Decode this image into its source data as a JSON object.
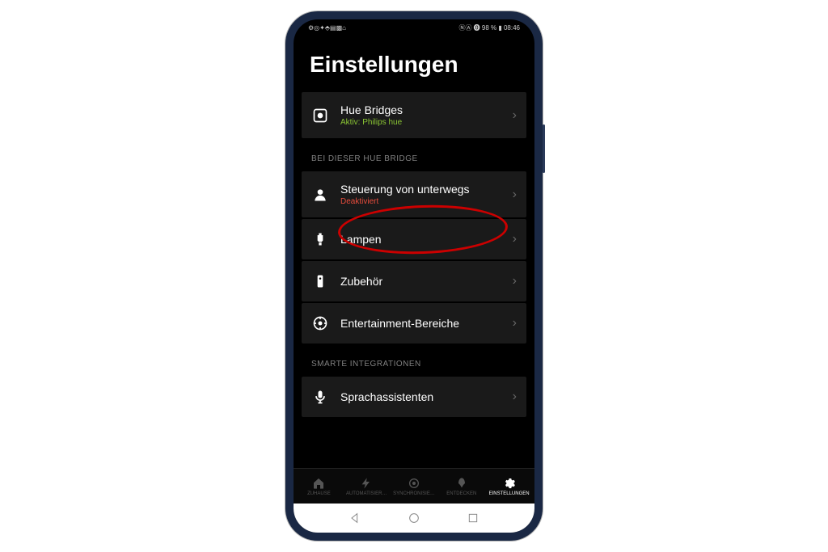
{
  "statusBar": {
    "leftIcons": "⚙◎✦⬘▤▩⌂",
    "rightText": "ⓃⒶ ⓿ 98 % ▮ 08:46"
  },
  "pageTitle": "Einstellungen",
  "settings": {
    "hueBridges": {
      "label": "Hue Bridges",
      "sublabel": "Aktiv: Philips hue"
    },
    "section1Header": "BEI DIESER HUE BRIDGE",
    "remoteControl": {
      "label": "Steuerung von unterwegs",
      "sublabel": "Deaktiviert"
    },
    "lights": {
      "label": "Lampen"
    },
    "accessories": {
      "label": "Zubehör"
    },
    "entertainment": {
      "label": "Entertainment-Bereiche"
    },
    "section2Header": "SMARTE INTEGRATIONEN",
    "voiceAssistants": {
      "label": "Sprachassistenten"
    }
  },
  "bottomNav": {
    "home": "ZUHAUSE",
    "automation": "AUTOMATISIER…",
    "sync": "SYNCHRONISIE…",
    "discover": "ENTDECKEN",
    "settings": "EINSTELLUNGEN"
  }
}
